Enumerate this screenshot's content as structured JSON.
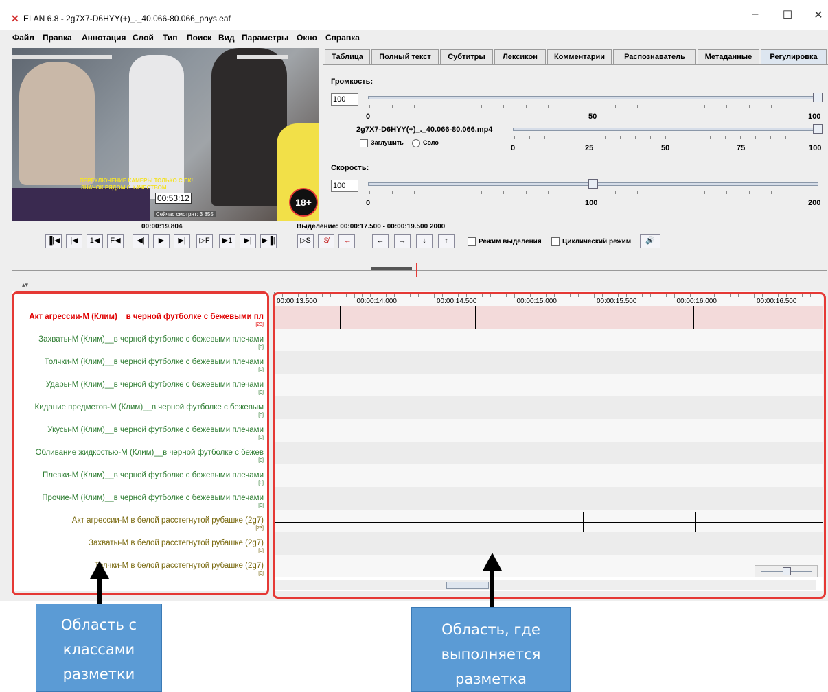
{
  "window": {
    "title": "ELAN 6.8 - 2g7X7-D6HYY(+)_._40.066-80.066_phys.eaf",
    "controls": [
      "–",
      "☐",
      "✕"
    ]
  },
  "menu": [
    "Файл",
    "Правка",
    "Аннотация",
    "Слой",
    "Тип",
    "Поиск",
    "Вид",
    "Параметры",
    "Окно",
    "Справка"
  ],
  "video": {
    "overlay_text_1": "ПЕРЕКЛЮЧЕНИЕ КАМЕРЫ ТОЛЬКО С ПК!",
    "overlay_text_2": "ЗНАЧОК РЯДОМ С КАЧЕСТВОМ",
    "stream_time": "00:53:12",
    "viewers": "Сейчас смотрят: 3 855",
    "age_badge": "18+"
  },
  "tabs": [
    {
      "label": "Таблица",
      "active": false
    },
    {
      "label": "Полный текст",
      "active": false
    },
    {
      "label": "Субтитры",
      "active": false
    },
    {
      "label": "Лексикон",
      "active": false
    },
    {
      "label": "Комментарии",
      "active": false
    },
    {
      "label": "Распознаватель",
      "active": false
    },
    {
      "label": "Метаданные",
      "active": false
    },
    {
      "label": "Регулировка",
      "active": true
    }
  ],
  "controls_panel": {
    "volume_label": "Громкость:",
    "volume_value": "100",
    "volume_ticks": [
      "0",
      "50",
      "100"
    ],
    "volume_level_percent": 100,
    "media_file": "2g7X7-D6HYY(+)_._40.066-80.066.mp4",
    "media_level_percent": 100,
    "media_ticks": [
      "0",
      "25",
      "50",
      "75",
      "100"
    ],
    "mute_label": "Заглушить",
    "solo_label": "Соло",
    "speed_label": "Скорость:",
    "speed_value": "100",
    "speed_ticks": [
      "0",
      "100",
      "200"
    ],
    "speed_level": 100,
    "speed_max": 200
  },
  "player": {
    "current_time": "00:00:19.804",
    "selection_text": "Выделение: 00:00:17.500 - 00:00:19.500  2000",
    "selection_mode_label": "Режим выделения",
    "loop_mode_label": "Циклический режим",
    "buttons": [
      "▐|◀",
      "|◀",
      "1◀",
      "F◀",
      "◀|",
      "▶",
      "▶|",
      "▷F",
      "▶1",
      "▶|",
      "▶▐|"
    ],
    "sel_buttons": [
      "▷S",
      "S̸",
      "|←"
    ],
    "nav_buttons": [
      "←",
      "→",
      "↓",
      "↑"
    ],
    "volume_icon": "🔊"
  },
  "ruler": [
    "00:00:13.500",
    "00:00:14.000",
    "00:00:14.500",
    "00:00:15.000",
    "00:00:15.500",
    "00:00:16.000",
    "00:00:16.500"
  ],
  "tiers": [
    {
      "name": "Акт агрессии-М (Клим)__в черной футболке с бежевыми пл",
      "count": "[23]",
      "color": "#e00000",
      "active": true
    },
    {
      "name": "Захваты-М (Клим)__в черной футболке с бежевыми плечами",
      "count": "[0]",
      "color": "#2e7d32",
      "active": false
    },
    {
      "name": "Толчки-М (Клим)__в черной футболке с бежевыми плечами",
      "count": "[0]",
      "color": "#2e7d32",
      "active": false
    },
    {
      "name": "Удары-М (Клим)__в черной футболке с бежевыми плечами",
      "count": "[0]",
      "color": "#2e7d32",
      "active": false
    },
    {
      "name": "Кидание предметов-М (Клим)__в черной футболке с бежевым",
      "count": "[0]",
      "color": "#2e7d32",
      "active": false
    },
    {
      "name": "Укусы-М (Клим)__в черной футболке с бежевыми плечами",
      "count": "[0]",
      "color": "#2e7d32",
      "active": false
    },
    {
      "name": "Обливание жидкостью-М (Клим)__в черной футболке с бежев",
      "count": "[0]",
      "color": "#2e7d32",
      "active": false
    },
    {
      "name": "Плевки-М (Клим)__в черной футболке с бежевыми плечами",
      "count": "[0]",
      "color": "#2e7d32",
      "active": false
    },
    {
      "name": "Прочие-М (Клим)__в черной футболке с бежевыми плечами",
      "count": "[0]",
      "color": "#2e7d32",
      "active": false
    },
    {
      "name": "Акт агрессии-М в белой расстегнутой рубашке (2g7)",
      "count": "[23]",
      "color": "#7a6a10",
      "active": false
    },
    {
      "name": "Захваты-М в белой расстегнутой рубашке (2g7)",
      "count": "[0]",
      "color": "#7a6a10",
      "active": false
    },
    {
      "name": "Толчки-М в белой расстегнутой рубашке (2g7)",
      "count": "[0]",
      "color": "#7a6a10",
      "active": false
    }
  ],
  "callouts": {
    "left": "Область с классами разметки",
    "right": "Область, где выполняется разметка"
  },
  "colors": {
    "highlight": "#e53935",
    "callout_bg": "#5b9bd5",
    "active_row": "#f3dada"
  }
}
